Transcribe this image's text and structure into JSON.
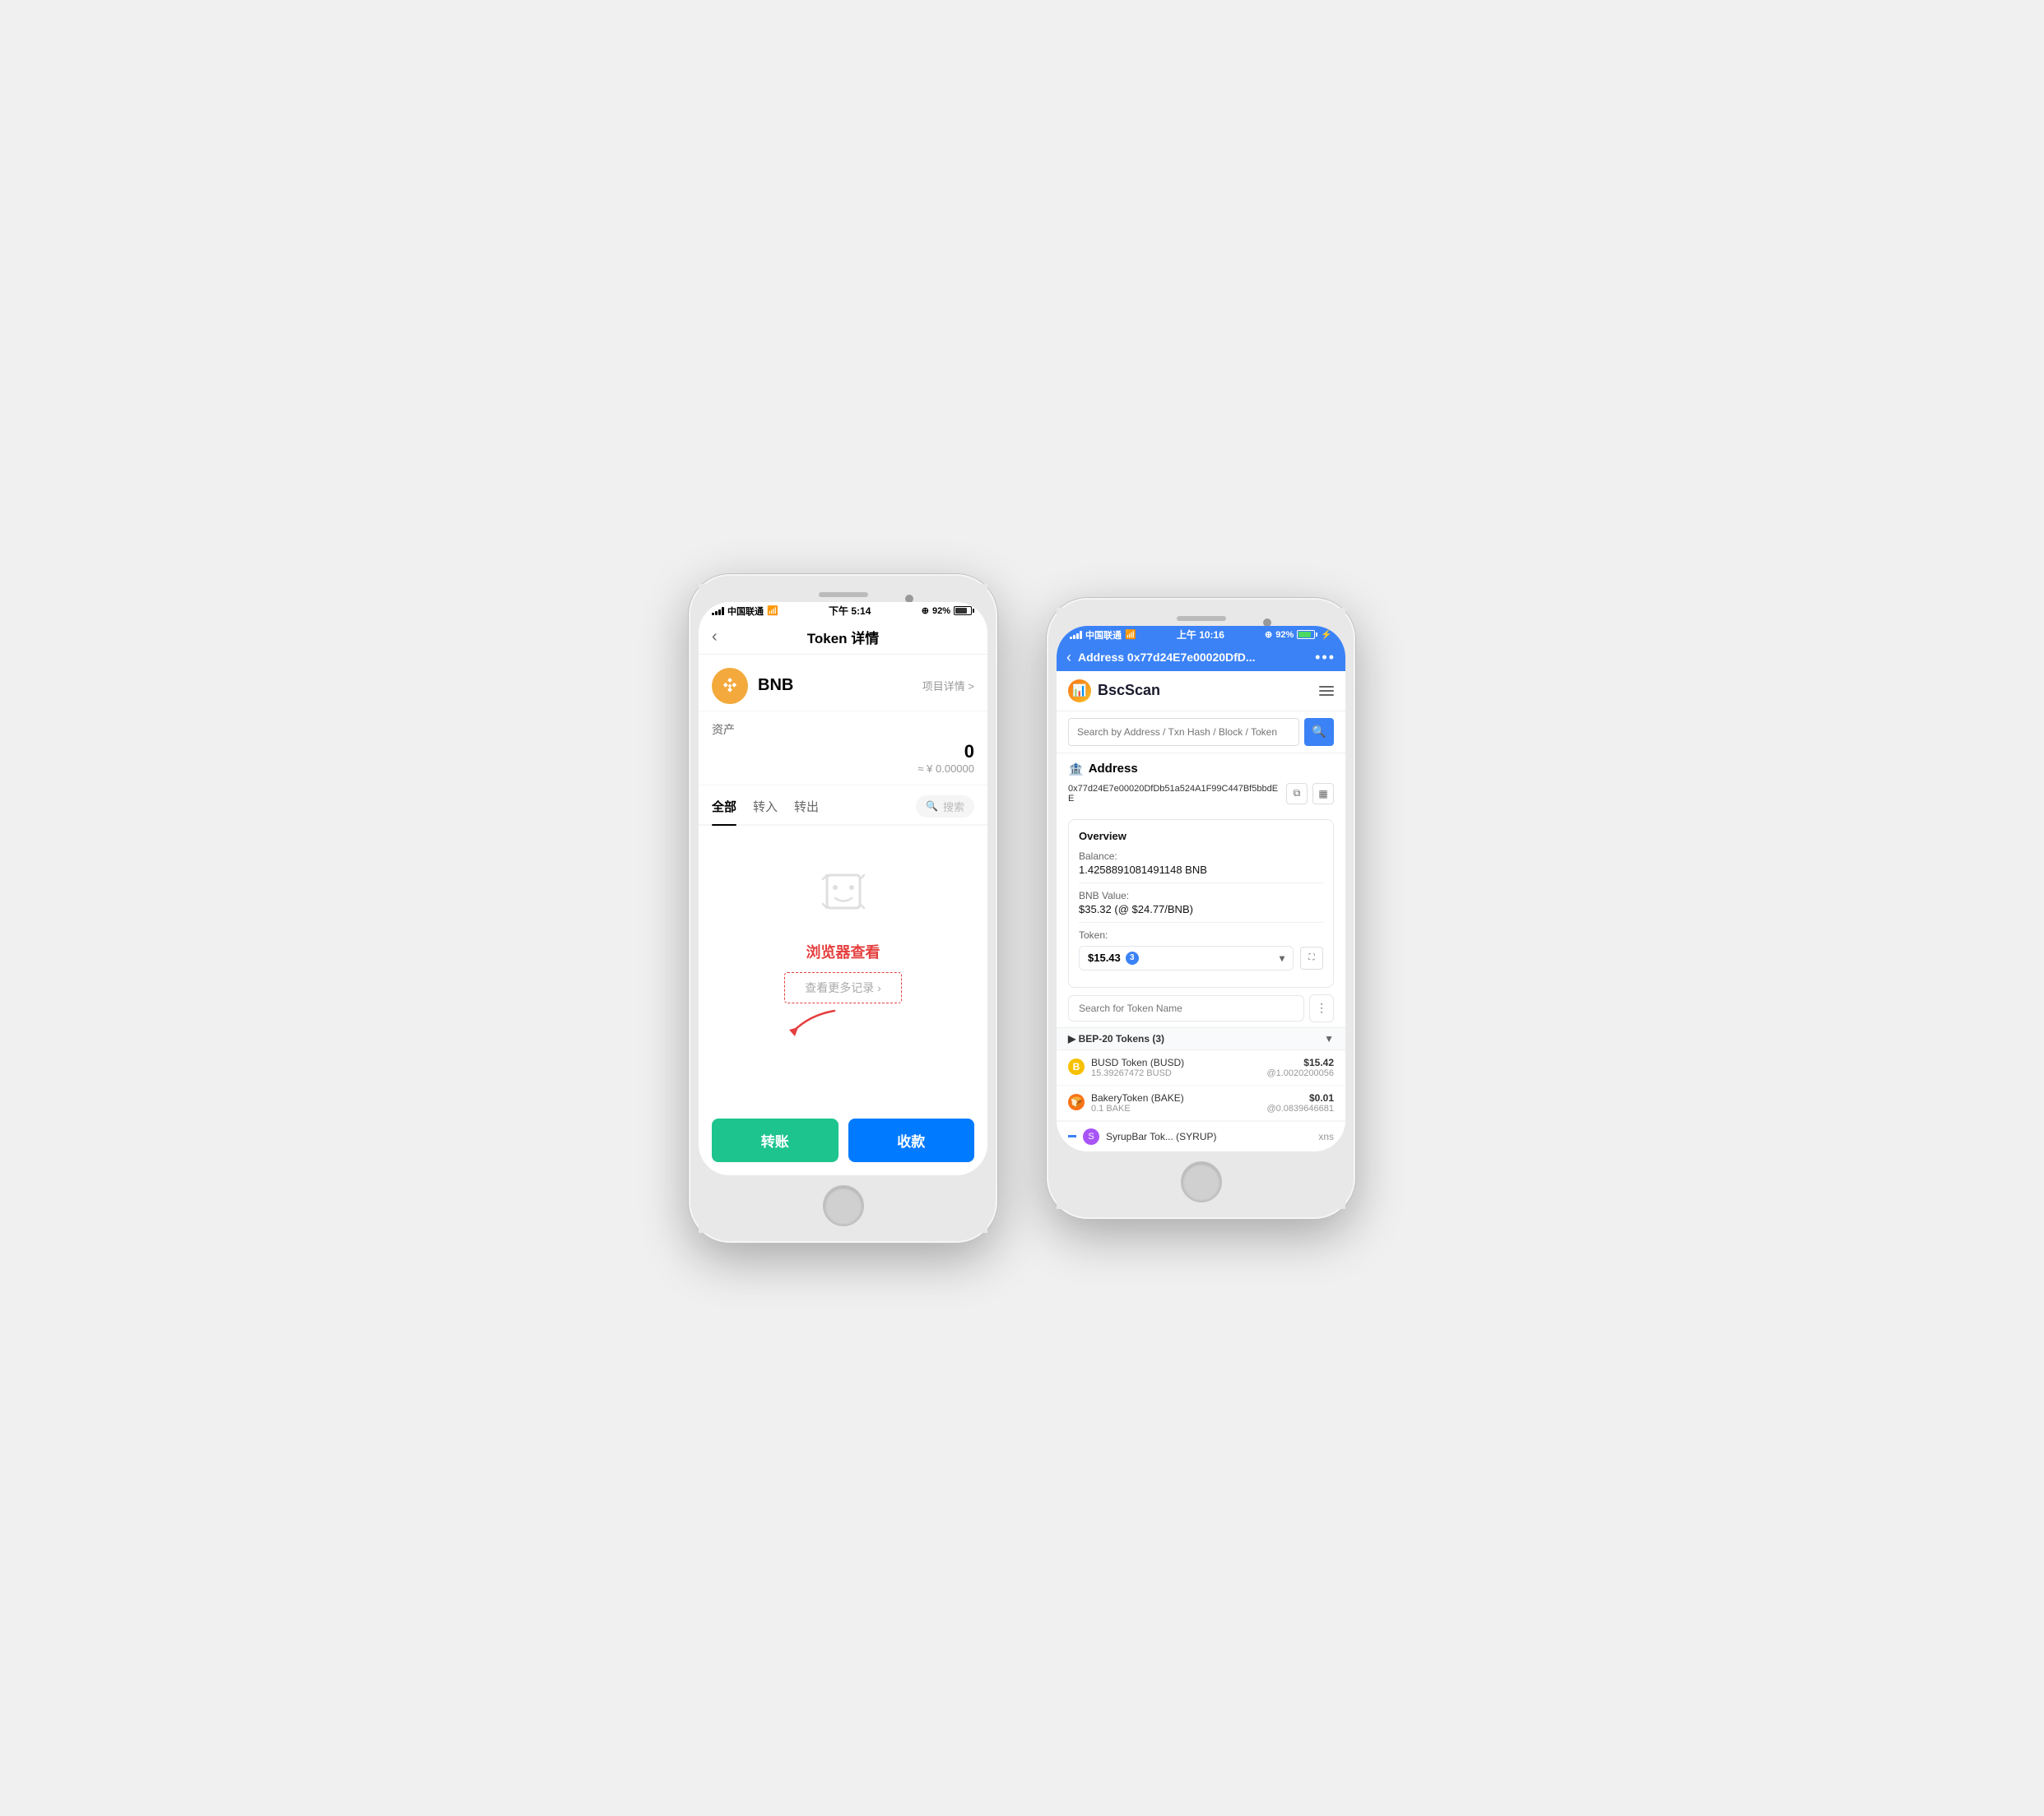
{
  "left_phone": {
    "status_bar": {
      "carrier": "中国联通",
      "time": "下午 5:14",
      "battery": "92%"
    },
    "nav_title": "Token 详情",
    "nav_back": "‹",
    "token_name": "BNB",
    "project_detail": "项目详情 >",
    "asset_label": "资产",
    "asset_amount": "0",
    "asset_value": "≈ ¥ 0.00000",
    "tabs": [
      "全部",
      "转入",
      "转出"
    ],
    "active_tab": "全部",
    "search_placeholder": "搜索",
    "empty_state": "",
    "browser_hint": "浏览器查看",
    "view_more": "查看更多记录 ›",
    "btn_transfer": "转账",
    "btn_receive": "收款"
  },
  "right_phone": {
    "status_bar": {
      "carrier": "中国联通",
      "time": "上午 10:16",
      "battery": "92%"
    },
    "blue_nav_title": "Address 0x77d24E7e00020DfD...",
    "blue_nav_back": "‹",
    "blue_nav_menu": "•••",
    "logo_text": "BscScan",
    "hamburger_menu": true,
    "search_placeholder": "Search by Address / Txn Hash / Block / Token",
    "search_btn_icon": "🔍",
    "address_title": "Address",
    "address_emoji": "🏦",
    "address_hash": "0x77d24E7e00020DfDb51a524A1F99C447Bf5bbdEE",
    "overview_title": "Overview",
    "balance_label": "Balance:",
    "balance_value": "1.4258891081491148 BNB",
    "bnb_value_label": "BNB Value:",
    "bnb_value": "$35.32 (@ $24.77/BNB)",
    "token_label": "Token:",
    "token_value": "$15.43",
    "token_count": "3",
    "token_search_placeholder": "Search for Token Name",
    "token_more_icon": "⋮",
    "bep20_label": "▶ BEP-20 Tokens (3)",
    "bep20_toggle": "▼",
    "tokens": [
      {
        "name": "BUSD Token (BUSD)",
        "amount": "15.39267472 BUSD",
        "value": "$15.42",
        "rate": "@1.0020200056",
        "icon_bg": "#f7c000",
        "icon_text": "B"
      },
      {
        "name": "BakeryToken (BAKE)",
        "amount": "0.1 BAKE",
        "value": "$0.01",
        "rate": "@0.0839646681",
        "icon_bg": "#f97316",
        "icon_text": "🍞"
      }
    ],
    "last_token_name": "SyrupBar Tok... (SYRUP)",
    "txns_label": "xns"
  }
}
